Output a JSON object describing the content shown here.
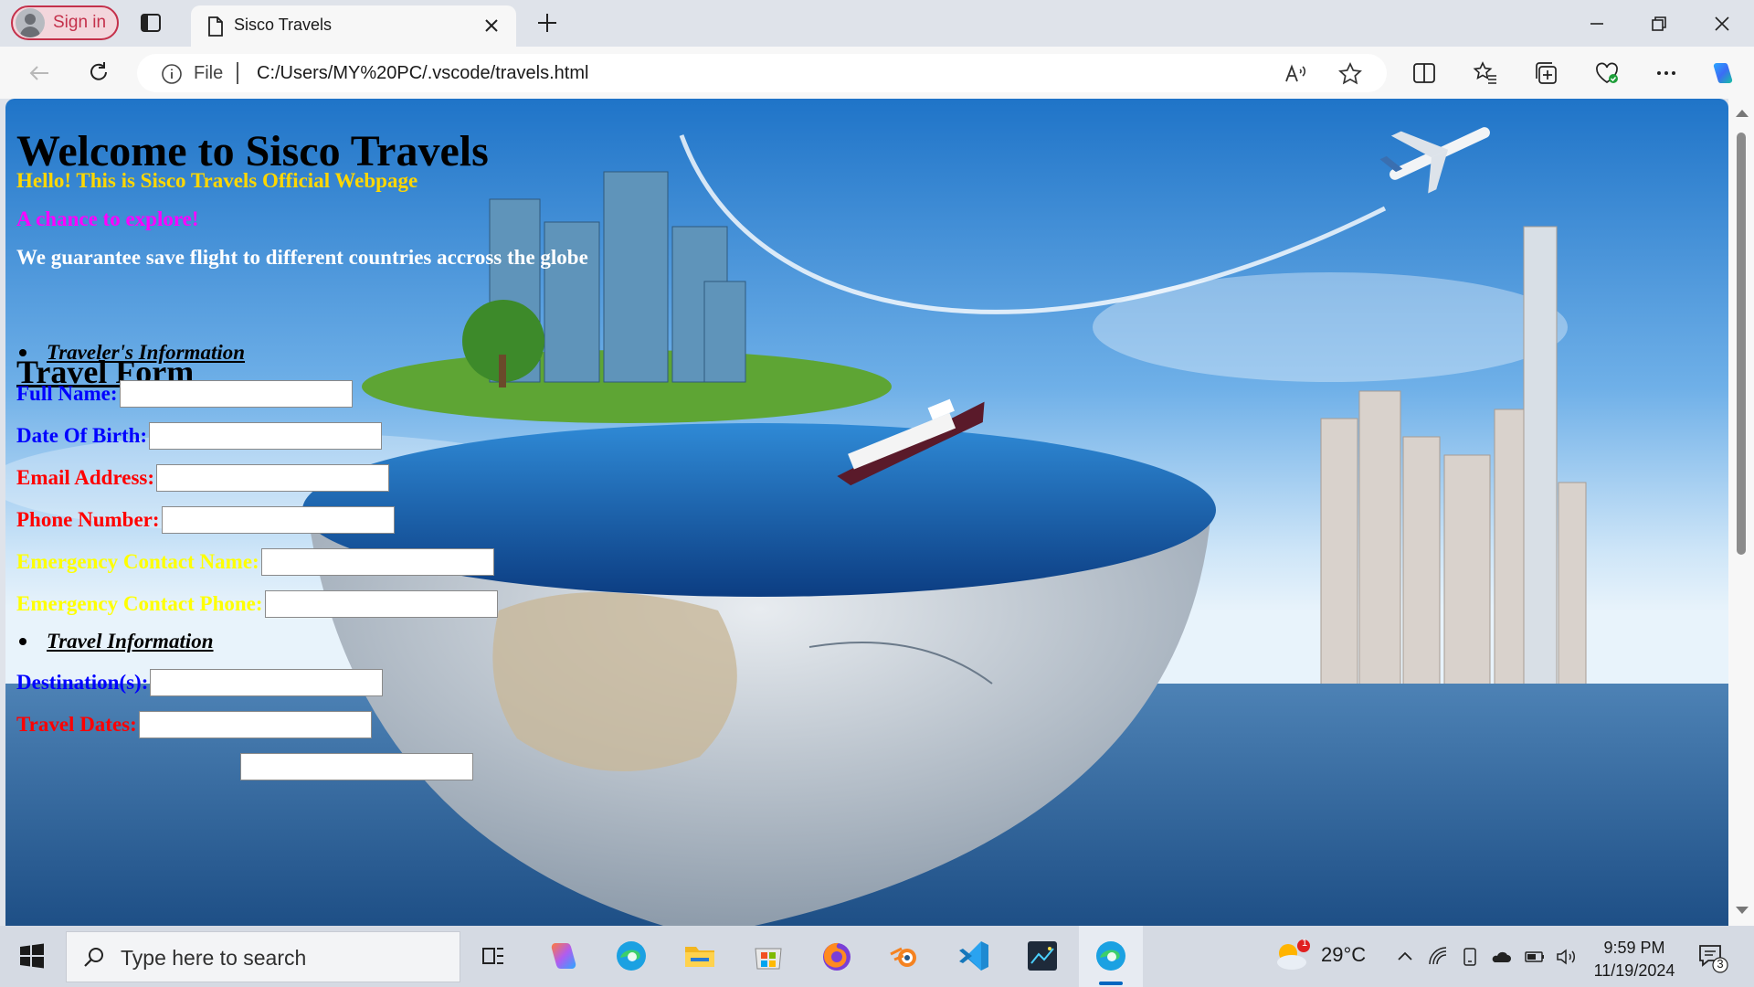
{
  "browser": {
    "signin_label": "Sign in",
    "tab_title": "Sisco Travels",
    "address": {
      "protocol_label": "File",
      "url": "C:/Users/MY%20PC/.vscode/travels.html"
    }
  },
  "page": {
    "heading": "Welcome to Sisco Travels",
    "lines": [
      {
        "text": "Hello! This is Sisco Travels Official Webpage",
        "color": "#ffd700"
      },
      {
        "text": "A chance to explore!",
        "color": "#ff00ff"
      },
      {
        "text": "We guarantee save flight to different countries accross the globe",
        "color": "#ffffff"
      }
    ],
    "form_title": "Travel Form",
    "sections": [
      {
        "label": "Traveler's Information"
      },
      {
        "label": "Travel Information"
      }
    ],
    "traveler_fields": [
      {
        "label": "Full Name:",
        "color": "#0000ff",
        "value": ""
      },
      {
        "label": "Date Of Birth:",
        "color": "#0000ff",
        "value": ""
      },
      {
        "label": "Email Address:",
        "color": "#ff0000",
        "value": ""
      },
      {
        "label": "Phone Number:",
        "color": "#ff0000",
        "value": ""
      },
      {
        "label": "Emergency Contact Name:",
        "color": "#ffff00",
        "value": ""
      },
      {
        "label": "Emergency Contact Phone:",
        "color": "#ffff00",
        "value": ""
      }
    ],
    "travel_fields": [
      {
        "label": "Destination(s):",
        "color": "#0000ff",
        "value": ""
      },
      {
        "label": "Travel Dates:",
        "color": "#ff0000",
        "value": ""
      }
    ]
  },
  "taskbar": {
    "search_placeholder": "Type here to search",
    "weather_temp": "29°C",
    "weather_badge": "1",
    "time": "9:59 PM",
    "date": "11/19/2024",
    "notification_count": "3"
  },
  "colors": {
    "accent": "#0067c0",
    "signin_red": "#c4314b"
  }
}
